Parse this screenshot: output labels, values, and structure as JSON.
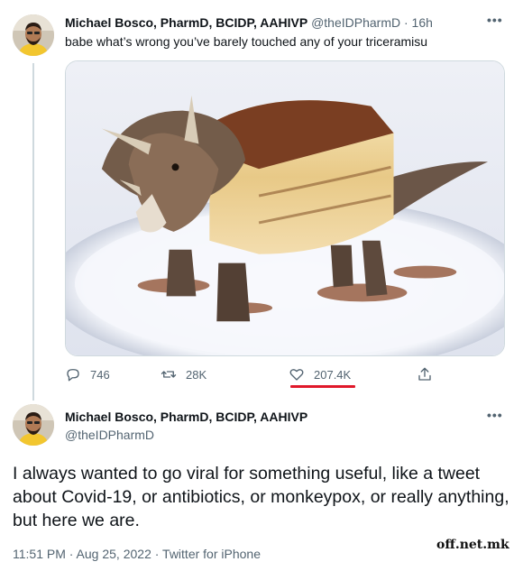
{
  "tweet1": {
    "author_name": "Michael Bosco, PharmD, BCIDP, AAHIVP",
    "handle_time": " @theIDPharmD · 16h",
    "more_icon": "more-horizontal-icon",
    "text": "babe what’s wrong you’ve barely touched any of your triceramisu",
    "stats": {
      "replies": "746",
      "retweets": "28K",
      "likes": "207.4K"
    },
    "icons": [
      "reply-icon",
      "retweet-icon",
      "heart-icon",
      "share-icon"
    ],
    "highlight_color": "#e0182a"
  },
  "tweet2": {
    "author_name": "Michael Bosco, PharmD, BCIDP, AAHIVP",
    "handle": "@theIDPharmD",
    "more_icon": "more-horizontal-icon",
    "text": "I always wanted to go viral for something useful, like a tweet about Covid-19, or antibiotics, or monkeypox, or really anything, but here we are.",
    "footer": "11:51 PM · Aug 25, 2022 · Twitter for iPhone"
  },
  "watermark": "off.net.mk",
  "colors": {
    "text_primary": "#0f1419",
    "text_secondary": "#536471",
    "divider": "#cfd9de"
  }
}
